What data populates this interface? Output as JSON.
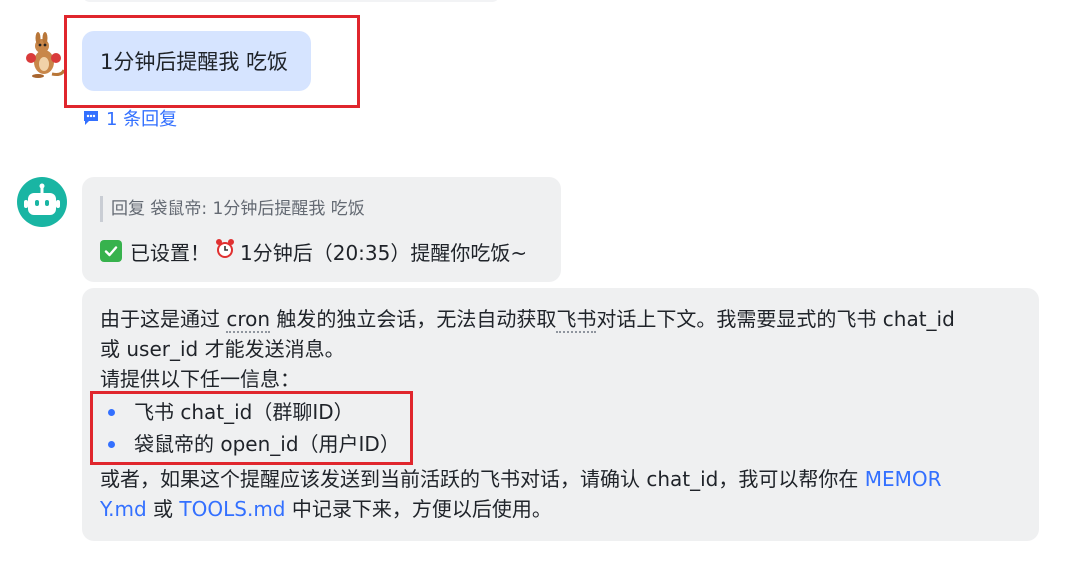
{
  "user_message": {
    "text": "1分钟后提醒我 吃饭",
    "reply_count": "1 条回复"
  },
  "bot_reply": {
    "quote": "回复 袋鼠帝: 1分钟后提醒我 吃饭",
    "status_prefix": "已设置！",
    "status_suffix": "1分钟后（20:35）提醒你吃饭~"
  },
  "bot_followup": {
    "line1_a": "由于这是通过 ",
    "line1_cron": "cron",
    "line1_b": " 触发的独立会话，无法自动获取",
    "line1_feishu": "飞书",
    "line1_c": "对话上下文。我需要显式的飞书 chat_id",
    "line2": "或 user_id 才能发送消息。",
    "line3": "请提供以下任一信息：",
    "bullets": [
      "飞书 chat_id（群聊ID）",
      "袋鼠帝的 open_id（用户ID）"
    ],
    "line6_a": "或者，如果这个提醒应该发送到当前活跃的飞书对话，请确认 chat_id，我可以帮你在 ",
    "line6_link": "MEMOR",
    "line7_link1": "Y.md",
    "line7_or": " 或 ",
    "line7_link2": "TOOLS.md",
    "line7_rest": " 中记录下来，方便以后使用。"
  },
  "colors": {
    "accent": "#3370ff",
    "highlight_box": "#e0262d",
    "user_bubble": "#d6e4ff",
    "bot_bubble": "#eff0f1",
    "bot_avatar": "#19b5a3"
  }
}
